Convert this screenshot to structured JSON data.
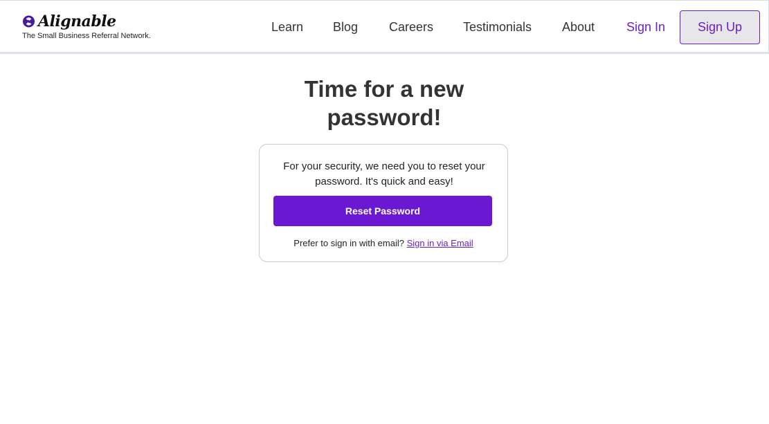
{
  "brand": {
    "name": "Alignable",
    "tagline": "The Small Business Referral Network.",
    "logo_icon": "alignable-logo-icon",
    "accent_color": "#6a18d1"
  },
  "nav": {
    "items": [
      {
        "label": "Learn"
      },
      {
        "label": "Blog"
      },
      {
        "label": "Careers"
      },
      {
        "label": "Testimonials"
      },
      {
        "label": "About"
      }
    ],
    "sign_in": "Sign In",
    "sign_up": "Sign Up"
  },
  "main": {
    "title": "Time for a new password!",
    "message": "For your security, we need you to reset your password. It's quick and easy!",
    "reset_button": "Reset Password",
    "alt_prompt": "Prefer to sign in with email?",
    "alt_link": "Sign in via Email"
  }
}
